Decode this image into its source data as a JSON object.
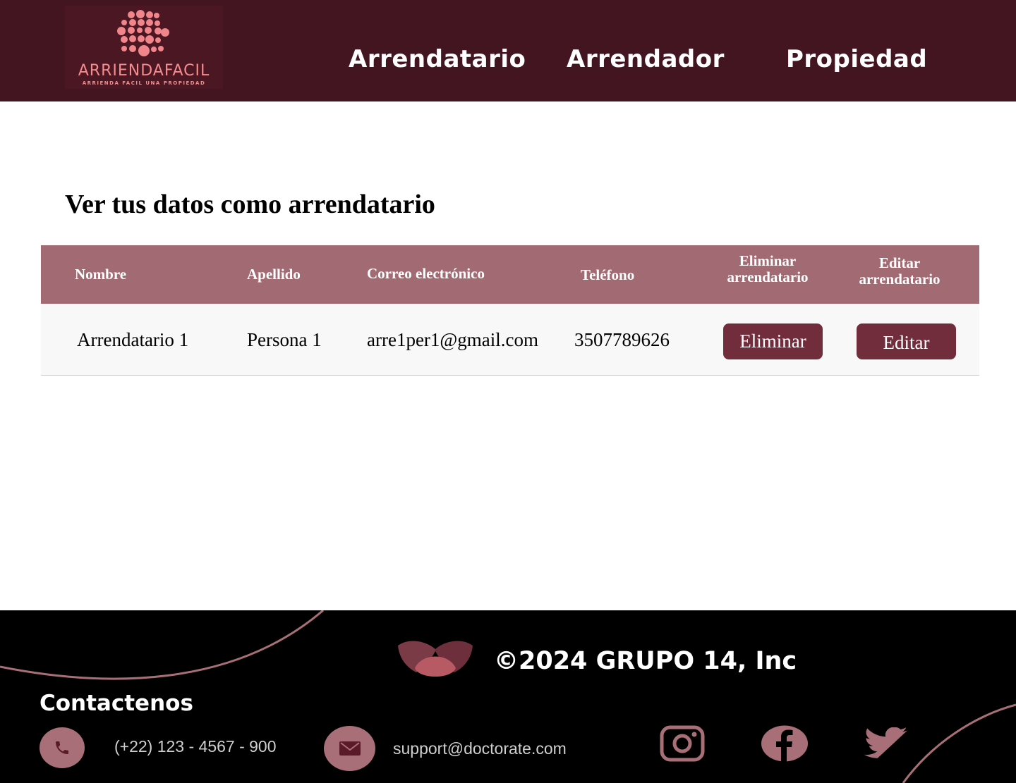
{
  "header": {
    "logo": {
      "name": "ARRIENDAFACIL",
      "tagline": "ARRIENDA FACIL UNA PROPIEDAD"
    },
    "nav": [
      {
        "label": "Arrendatario"
      },
      {
        "label": "Arrendador"
      },
      {
        "label": "Propiedad"
      }
    ]
  },
  "main": {
    "title": "Ver tus datos como arrendatario",
    "table": {
      "headers": {
        "nombre": "Nombre",
        "apellido": "Apellido",
        "correo": "Correo electrónico",
        "telefono": "Teléfono",
        "eliminar_line1": "Eliminar",
        "eliminar_line2": "arrendatario",
        "editar_line1": "Editar",
        "editar_line2": "arrendatario"
      },
      "rows": [
        {
          "nombre": "Arrendatario 1",
          "apellido": "Persona 1",
          "correo": "arre1per1@gmail.com",
          "telefono": "3507789626",
          "delete_label": "Eliminar",
          "edit_label": "Editar"
        }
      ]
    }
  },
  "footer": {
    "copyright": "©2024 GRUPO 14, Inc",
    "contact_title": "Contactenos",
    "phone": "(+22) 123 - 4567 - 900",
    "email": "support@doctorate.com",
    "icons": [
      "phone-icon",
      "mail-icon",
      "instagram-icon",
      "facebook-icon",
      "twitter-icon"
    ]
  },
  "colors": {
    "header_bg": "#431520",
    "table_header_bg": "#a26a72",
    "button_bg": "#722d3d",
    "footer_bg": "#000000",
    "accent_pink": "#a86f78",
    "logo_pink": "#f58b8f"
  }
}
